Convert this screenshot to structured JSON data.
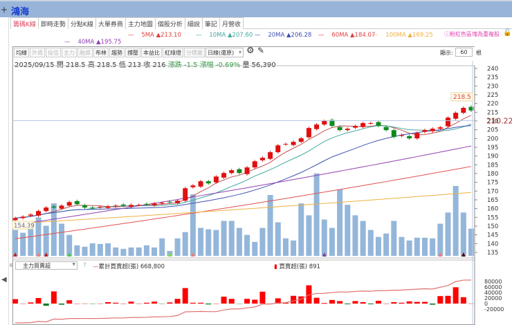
{
  "header": {
    "title": "鴻海",
    "add_icon": "plus-icon"
  },
  "tabs": [
    "籌碼K線",
    "即時走勢",
    "分點K線",
    "大單券商",
    "主力地圖",
    "個股分析",
    "細說",
    "筆記",
    "月營收"
  ],
  "ma_legend": [
    {
      "label": "5MA",
      "value": "213.10",
      "color": "#e04040"
    },
    {
      "label": "10MA",
      "value": "207.60",
      "color": "#40a8a0"
    },
    {
      "label": "20MA",
      "value": "206.28",
      "color": "#4050b0"
    },
    {
      "label": "60MA",
      "value": "184.07",
      "color": "#e04040"
    },
    {
      "label": "100MA",
      "value": "169.25",
      "color": "#f0b040"
    },
    {
      "label": "40MA",
      "value": "195.75",
      "color": "#9040b0"
    }
  ],
  "hint": "ⓘ粉紅色區塊為重複股",
  "toolbar": {
    "buttons": [
      "均線",
      "外資",
      "投信",
      "主力",
      "融資",
      "布林",
      "趨勢",
      "撐壓",
      "本益比",
      "紅綠燈",
      "分價量"
    ],
    "disabled": [
      1,
      2,
      3,
      4,
      10
    ],
    "period": "日線(還原)",
    "show_label": "顯示:",
    "show_value": "60",
    "show_unit": "根"
  },
  "info": {
    "date": "2025/09/15",
    "open_label": "開",
    "open": "218.5",
    "high_label": "高",
    "high": "218.5",
    "low_label": "低",
    "low": "213",
    "close_label": "收",
    "close": "216",
    "chg_label": "漲跌",
    "chg": "-1.5",
    "pct_label": "漲幅",
    "pct": "-0.69%",
    "vol_label": "量",
    "vol": "56,390"
  },
  "main_force": {
    "select": "主力買賣超",
    "cum_label": "累計買賣超(張)",
    "cum_value": "668,800",
    "day_label": "買賣超(張)",
    "day_value": "891"
  },
  "chart_data": {
    "type": "candlestick",
    "price_ticks": [
      240,
      235,
      230,
      225,
      220,
      215,
      210,
      205,
      200,
      195,
      190,
      185,
      180,
      175,
      170,
      165,
      160,
      155,
      150,
      145,
      140,
      135
    ],
    "price_range": [
      131,
      242
    ],
    "crosshair_price": "210.22",
    "high_tag": "218.5",
    "low_tag": "154.39",
    "closes": [
      154.6,
      155.4,
      156.6,
      158.6,
      160.6,
      160.6,
      161.7,
      163.7,
      162.5,
      160.6,
      160.2,
      161,
      161.3,
      161.7,
      161.7,
      162.1,
      162.1,
      162.5,
      162.9,
      163.3,
      163.7,
      164.5,
      171.6,
      173.2,
      175.6,
      174.4,
      178.3,
      180.3,
      181.9,
      180.3,
      183.5,
      187,
      189,
      192.2,
      196.1,
      196.9,
      198.1,
      200.1,
      206,
      208,
      210,
      207.2,
      204.8,
      205.6,
      207.2,
      208.8,
      208.8,
      207.2,
      204.8,
      200.9,
      202,
      200.1,
      203.2,
      204.8,
      205.6,
      206.4,
      211.9,
      214.7,
      217.5,
      216
    ],
    "volumes": [
      53700,
      47900,
      58000,
      79800,
      62400,
      108800,
      66700,
      43500,
      21800,
      18900,
      26100,
      24700,
      26100,
      17400,
      14500,
      17400,
      17400,
      21800,
      17400,
      36300,
      10200,
      36300,
      49300,
      127600,
      58000,
      55100,
      53700,
      72500,
      72500,
      58000,
      43500,
      29000,
      58000,
      126200,
      69600,
      36300,
      31900,
      108800,
      84100,
      171100,
      75400,
      58000,
      137800,
      105900,
      84100,
      72500,
      53700,
      39200,
      46400,
      72500,
      39200,
      31900,
      37700,
      37700,
      36300,
      66700,
      89900,
      145000,
      89900,
      56390
    ],
    "ma_long": [
      {
        "period": 40,
        "start": 150.7,
        "end": 195.75
      },
      {
        "period": 60,
        "start": 142.8,
        "end": 184.07
      },
      {
        "period": 100,
        "start": 151.5,
        "end": 169.25
      }
    ],
    "main_force_ticks": [
      80000,
      60000,
      40000,
      20000,
      0,
      -20000
    ],
    "main_force_values": [
      16000,
      0,
      4000,
      20000,
      -8000,
      44000,
      -4000,
      12000,
      0,
      500,
      -500,
      500,
      5000,
      3000,
      0,
      7000,
      500,
      3000,
      7000,
      -500,
      4000,
      17000,
      56000,
      3000,
      3000,
      -3000,
      0,
      25000,
      17000,
      -500,
      17000,
      14000,
      43000,
      500,
      19000,
      3000,
      28000,
      26000,
      66000,
      21000,
      2000,
      13000,
      9000,
      -1000,
      9000,
      5000,
      -2000,
      10000,
      0,
      5000,
      3000,
      8000,
      6000,
      6000,
      -4000,
      27000,
      28000,
      59000,
      23000,
      891
    ]
  }
}
